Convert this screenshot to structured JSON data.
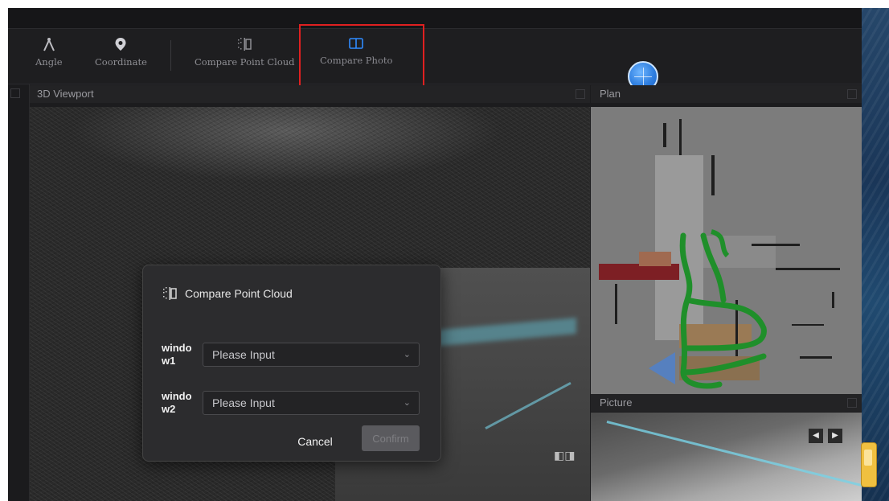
{
  "toolbar": {
    "tools": [
      {
        "label": "Angle",
        "icon": "angle-icon"
      },
      {
        "label": "Coordinate",
        "icon": "location-pin-icon"
      },
      {
        "label": "Compare Point Cloud",
        "icon": "compare-point-cloud-icon"
      },
      {
        "label": "Compare Photo",
        "icon": "compare-photo-icon"
      }
    ],
    "highlight_color": "#e02020",
    "active_color": "#2f8bff"
  },
  "panels": {
    "viewport_title": "3D Viewport",
    "plan_title": "Plan",
    "picture_title": "Picture",
    "picture_prev": "◀",
    "picture_next": "▶"
  },
  "dialog": {
    "title": "Compare Point Cloud",
    "fields": [
      {
        "label": "window1",
        "placeholder": "Please Input"
      },
      {
        "label": "window2",
        "placeholder": "Please Input"
      }
    ],
    "cancel_label": "Cancel",
    "confirm_label": "Confirm"
  },
  "colors": {
    "app_bg": "#1c1c1e",
    "path_green": "#1f8f2a",
    "compass_blue": "#2f7fe0"
  }
}
